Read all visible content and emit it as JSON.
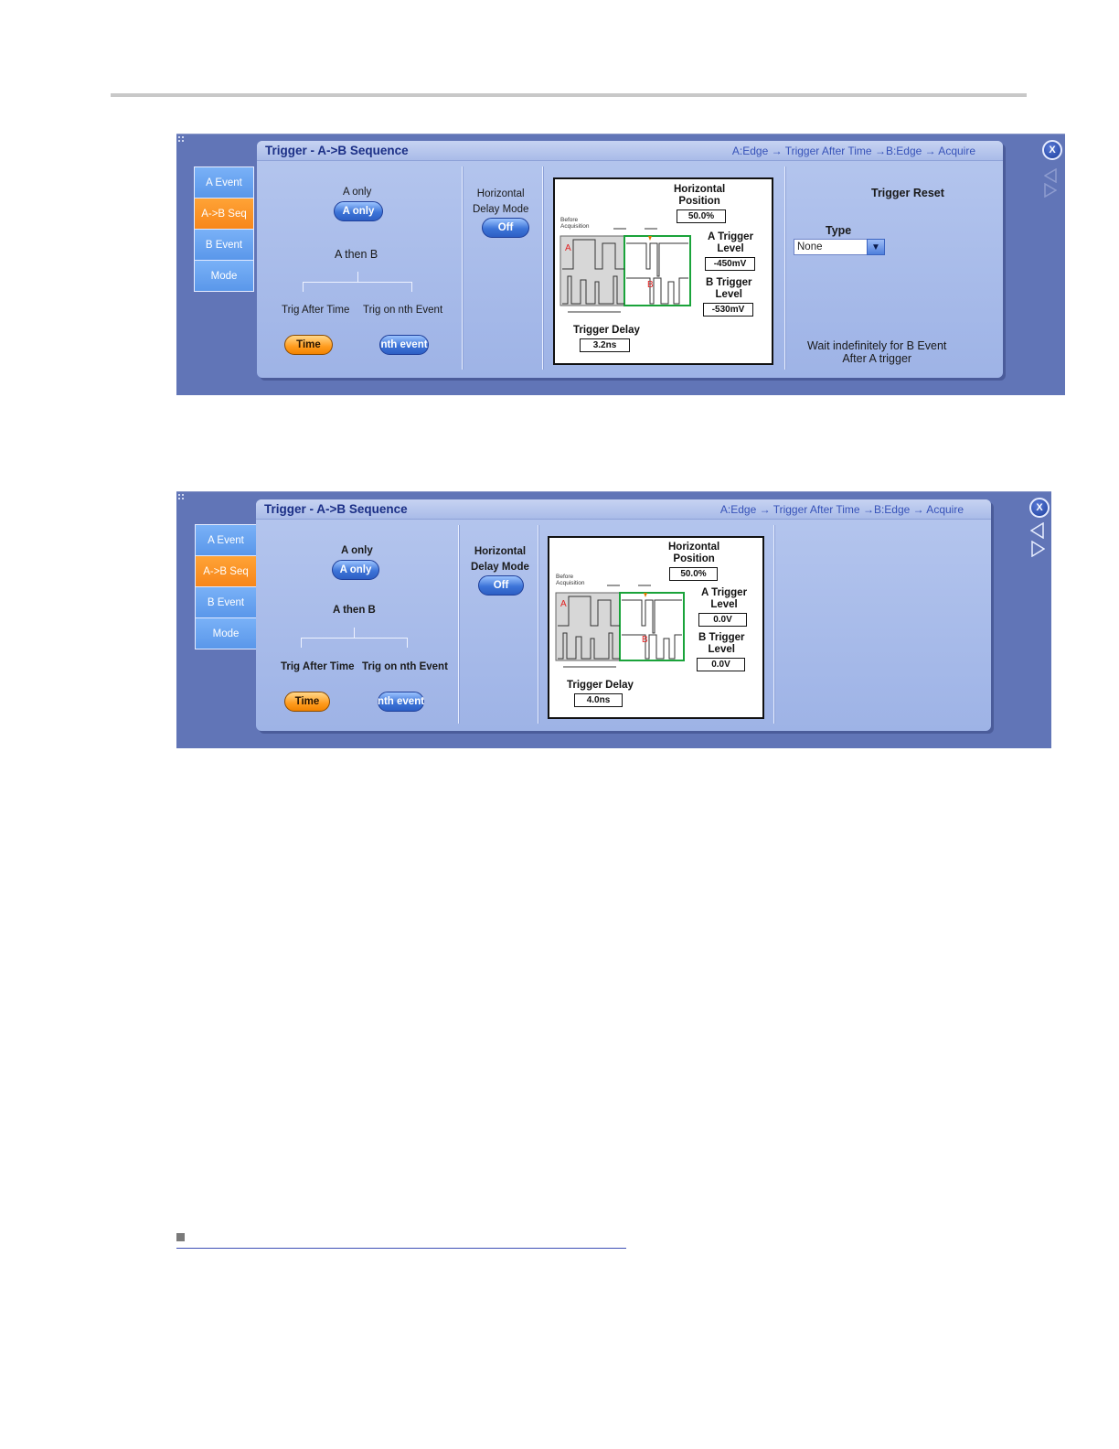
{
  "dialogs": [
    {
      "title": "Trigger - A->B Sequence",
      "breadcrumb": "A:Edge → Trigger After Time →B:Edge → Acquire",
      "tabs": [
        "A Event",
        "A->B Seq",
        "B Event",
        "Mode"
      ],
      "active_tab": "A->B Seq",
      "a_only_label": "A only",
      "a_only_button": "A only",
      "a_then_b_label": "A then B",
      "trig_after_time_label": "Trig After Time",
      "trig_nth_event_label": "Trig on nth Event",
      "time_button": "Time",
      "nth_event_button": "nth event",
      "horizontal_delay_mode_label": "Horizontal\nDelay Mode",
      "delay_mode_button": "Off",
      "diagram": {
        "horizontal_position_label": "Horizontal\nPosition",
        "horizontal_position_value": "50.0%",
        "before_acquisition_label": "Before\nAcquisition",
        "a_trigger_level_label": "A Trigger\nLevel",
        "a_trigger_level_value": "-450mV",
        "b_trigger_level_label": "B Trigger\nLevel",
        "b_trigger_level_value": "-530mV",
        "trigger_delay_label": "Trigger Delay",
        "trigger_delay_value": "3.2ns",
        "marker_a": "A",
        "marker_b": "B"
      },
      "trigger_reset": {
        "heading": "Trigger Reset",
        "type_label": "Type",
        "type_value": "None",
        "message": "Wait indefinitely for B Event\nAfter A trigger"
      },
      "close_label": "X"
    },
    {
      "title": "Trigger - A->B Sequence",
      "breadcrumb": "A:Edge → Trigger After Time →B:Edge → Acquire",
      "tabs": [
        "A Event",
        "A->B Seq",
        "B Event",
        "Mode"
      ],
      "active_tab": "A->B Seq",
      "a_only_label": "A only",
      "a_only_button": "A only",
      "a_then_b_label": "A then B",
      "trig_after_time_label": "Trig After Time",
      "trig_nth_event_label": "Trig on nth Event",
      "time_button": "Time",
      "nth_event_button": "nth event",
      "horizontal_delay_mode_label": "Horizontal\nDelay Mode",
      "delay_mode_button": "Off",
      "diagram": {
        "horizontal_position_label": "Horizontal\nPosition",
        "horizontal_position_value": "50.0%",
        "before_acquisition_label": "Before\nAcquisition",
        "a_trigger_level_label": "A Trigger\nLevel",
        "a_trigger_level_value": "0.0V",
        "b_trigger_level_label": "B Trigger\nLevel",
        "b_trigger_level_value": "0.0V",
        "trigger_delay_label": "Trigger Delay",
        "trigger_delay_value": "4.0ns",
        "marker_a": "A",
        "marker_b": "B"
      },
      "close_label": "X"
    }
  ],
  "colors": {
    "dialog_background": "#6175b7",
    "panel_background": "#a9bbe8",
    "tab_blue": "#5a97ea",
    "tab_active_orange": "#f7861a",
    "title_text": "#1b2f86",
    "waveform_box_green": "#1aa33a",
    "marker_red": "#e02020"
  }
}
